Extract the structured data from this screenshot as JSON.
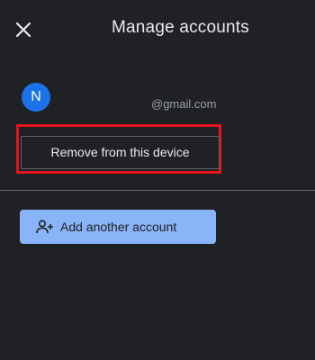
{
  "header": {
    "close_icon": "close-icon",
    "title": "Manage accounts"
  },
  "account": {
    "avatar_initial": "N",
    "avatar_color": "#1a73e8",
    "email": "@gmail.com"
  },
  "actions": {
    "remove_label": "Remove from this device",
    "highlight_color": "#e5141d",
    "add_icon": "person-add-icon",
    "add_label": "Add another account",
    "add_button_color": "#8ab4f8"
  },
  "theme": {
    "background": "#202124"
  }
}
